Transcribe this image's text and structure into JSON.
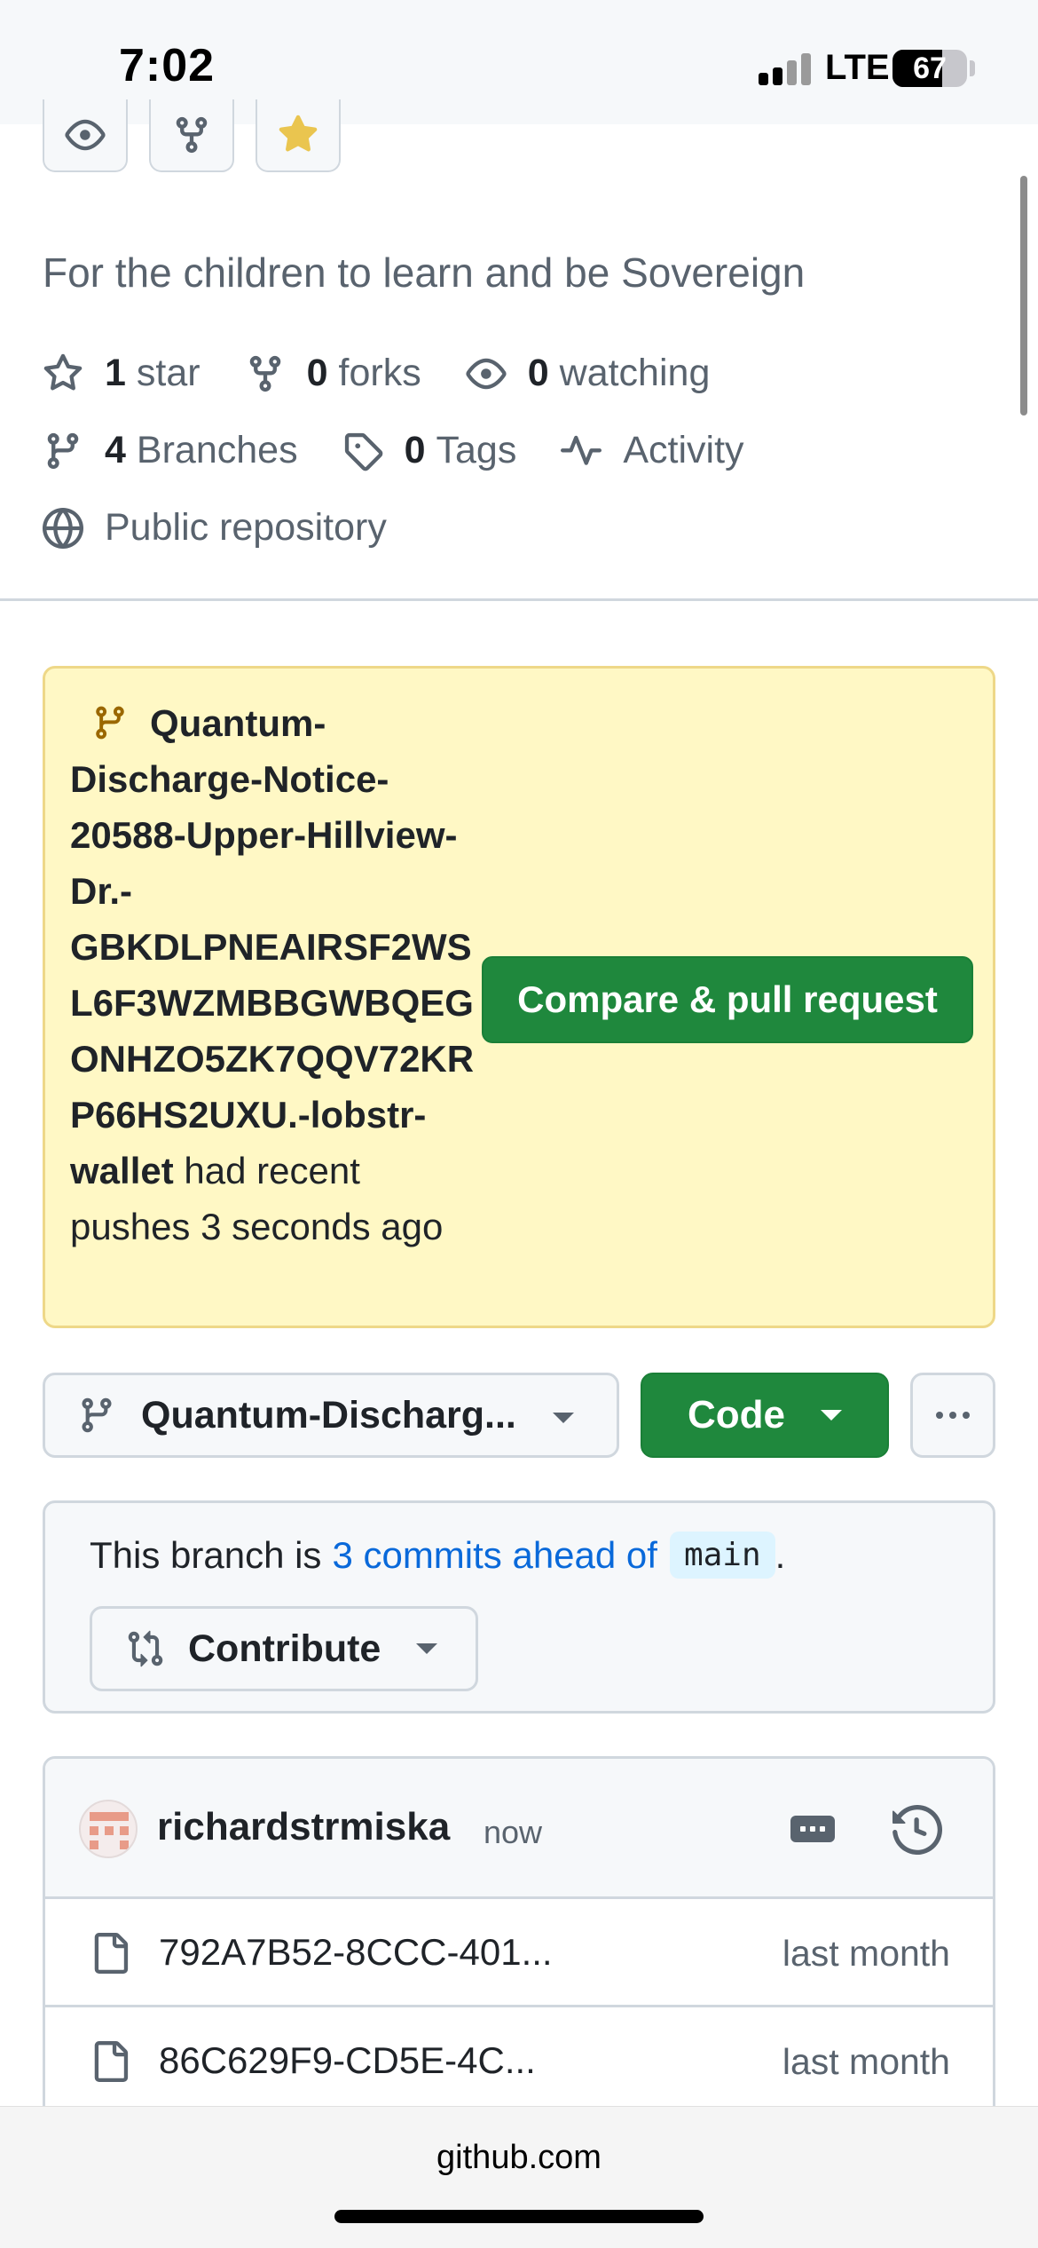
{
  "status_bar": {
    "time": "7:02",
    "network": "LTE",
    "battery": "67",
    "battery_level": 0.67
  },
  "header_actions": [
    {
      "icon": "eye-icon",
      "name": "watch-button"
    },
    {
      "icon": "fork-icon",
      "name": "fork-button"
    },
    {
      "icon": "star-filled-icon",
      "name": "star-button"
    }
  ],
  "repo": {
    "description": "For the children to learn and be Sovereign",
    "stars_count": "1",
    "stars_label": "star",
    "forks_count": "0",
    "forks_label": "forks",
    "watching_count": "0",
    "watching_label": "watching",
    "branches_count": "4",
    "branches_label": "Branches",
    "tags_count": "0",
    "tags_label": "Tags",
    "activity_label": "Activity",
    "visibility": "Public repository"
  },
  "push_banner": {
    "branch_name": "Quantum-Discharge-Notice-20588-Upper-Hillview-Dr.-GBKDLPNEAIRSF2WSL6F3WZMBBGWBQEGONHZO5ZK7QQV72KRP66HS2UXU.-lobstr-wallet",
    "message": " had recent pushes 3 seconds ago",
    "compare_label": "Compare & pull request"
  },
  "branch_bar": {
    "selected_branch": "Quantum-Discharg...",
    "code_label": "Code"
  },
  "ahead": {
    "prefix": "This branch is",
    "link": "3 commits ahead of",
    "base": "main",
    "suffix": ".",
    "contribute_label": "Contribute"
  },
  "latest_commit": {
    "author": "richardstrmiska",
    "time": "now"
  },
  "files": [
    {
      "name": "792A7B52-8CCC-401...",
      "date": "last month"
    },
    {
      "name": "86C629F9-CD5E-4C...",
      "date": "last month"
    },
    {
      "name": "",
      "date": ""
    }
  ],
  "browser": {
    "url": "github.com"
  },
  "colors": {
    "primary_button": "#1f883d",
    "banner_bg": "#fff8c5",
    "link": "#0969da",
    "star": "#eac54f"
  }
}
